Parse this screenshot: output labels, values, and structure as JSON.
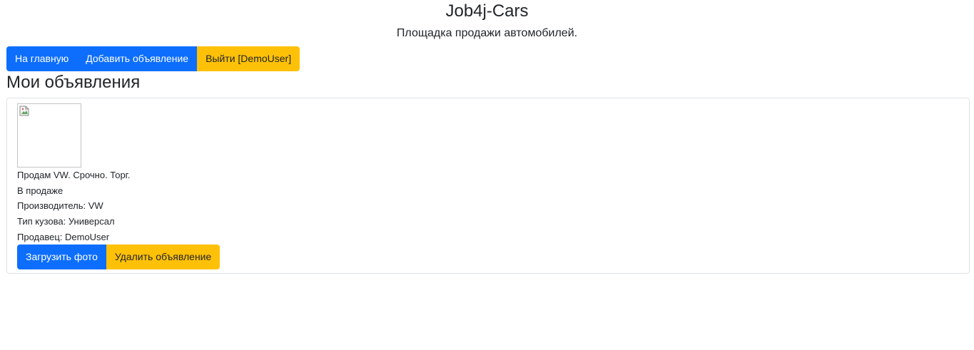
{
  "header": {
    "title": "Job4j-Cars",
    "subtitle": "Площадка продажи автомобилей."
  },
  "nav": {
    "home_label": "На главную",
    "add_ad_label": "Добавить объявление",
    "logout_label": "Выйти [DemoUser]"
  },
  "main": {
    "heading": "Мои объявления",
    "ads": [
      {
        "image_icon": "broken-image-icon",
        "description": "Продам VW. Срочно. Торг.",
        "status": "В продаже",
        "manufacturer": "Производитель: VW",
        "body_type": "Тип кузова: Универсал",
        "seller": "Продавец: DemoUser",
        "upload_photo_label": "Загрузить фото",
        "delete_label": "Удалить объявление"
      }
    ]
  },
  "colors": {
    "primary": "#0d6efd",
    "warning": "#ffc107",
    "text": "#212529",
    "border": "#dee2e6"
  }
}
